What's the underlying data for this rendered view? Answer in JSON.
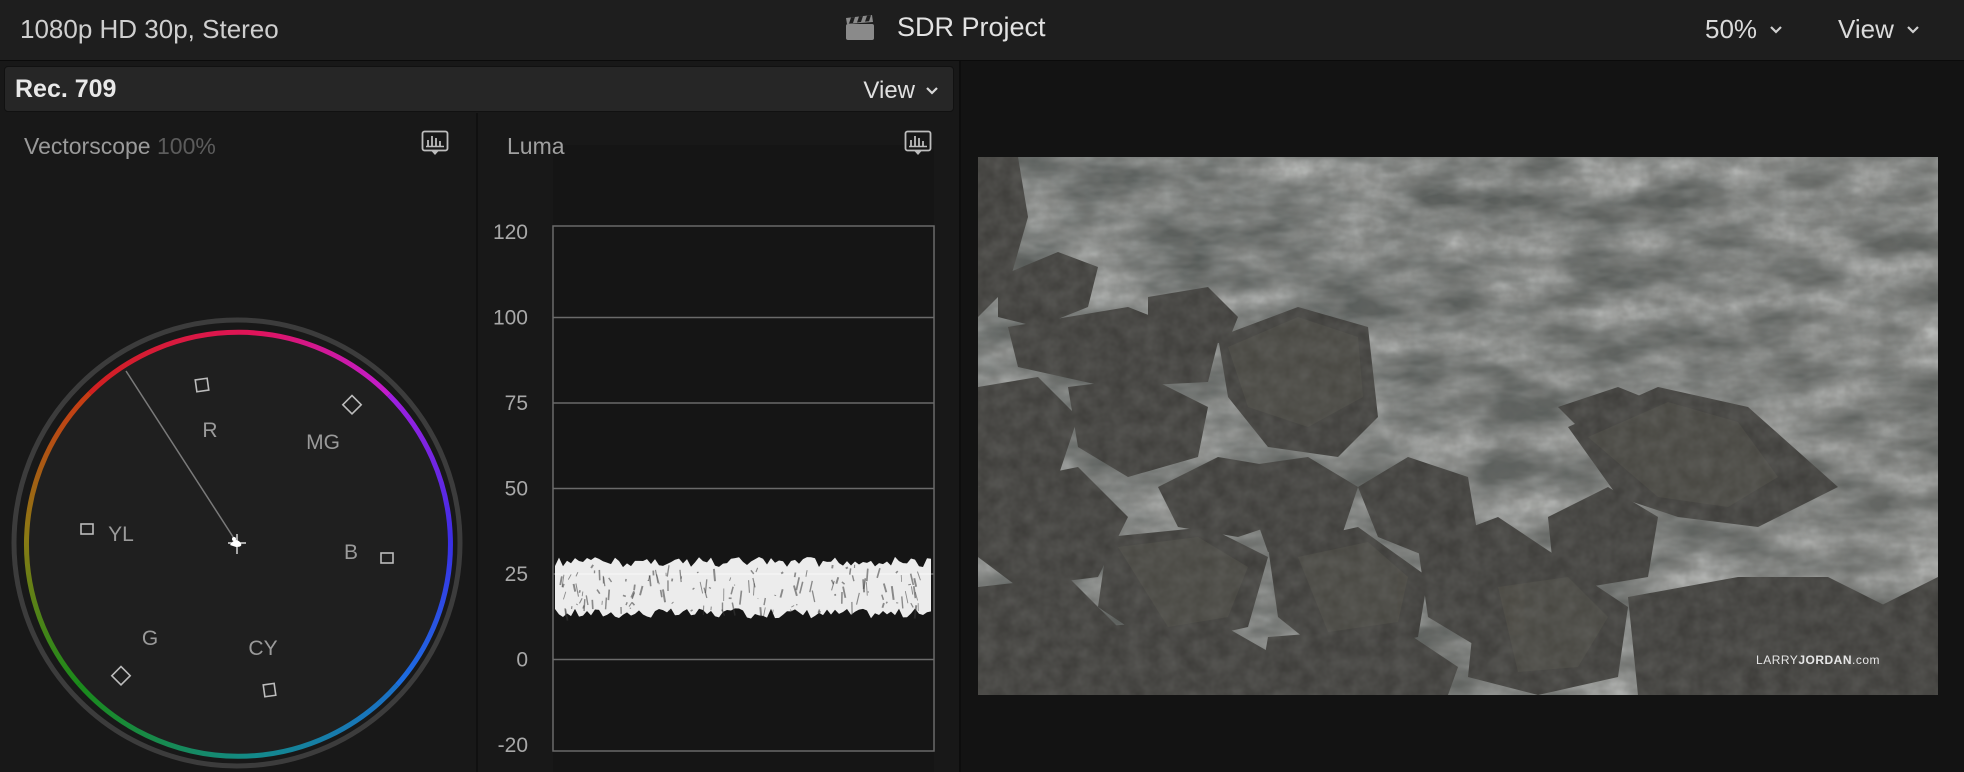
{
  "topbar": {
    "format": "1080p HD 30p, Stereo",
    "project_title": "SDR Project",
    "zoom": "50%",
    "view_label": "View"
  },
  "scopes": {
    "colorspace": "Rec. 709",
    "view_label": "View",
    "vectorscope": {
      "title": "Vectorscope",
      "percent": "100%",
      "targets": [
        "R",
        "MG",
        "B",
        "CY",
        "G",
        "YL"
      ]
    },
    "luma": {
      "title": "Luma",
      "ticks": [
        "120",
        "100",
        "75",
        "50",
        "25",
        "0",
        "-20"
      ],
      "waveform_range": [
        12,
        30
      ]
    }
  },
  "viewer": {
    "watermark_light": "LARRY",
    "watermark_bold": "JORDAN",
    "watermark_end": ".com"
  },
  "colors": {
    "background": "#141414",
    "panel": "#181818",
    "waveform": "#ffffff"
  }
}
